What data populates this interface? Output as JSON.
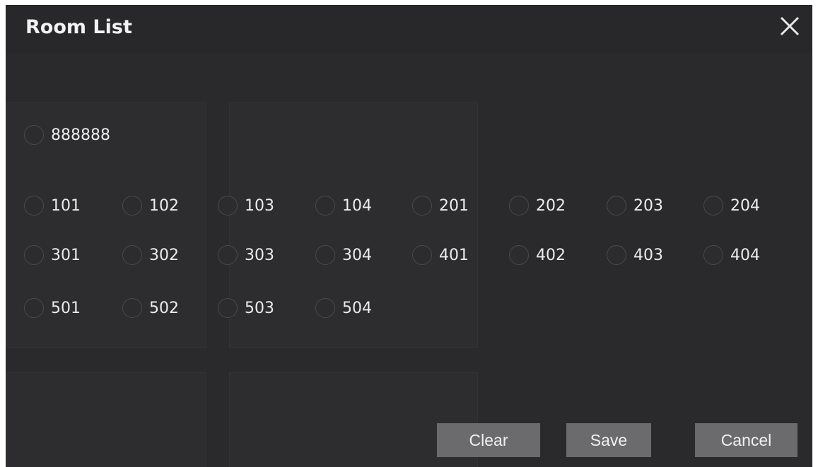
{
  "dialog": {
    "title": "Room List",
    "close_icon": "close-icon"
  },
  "rooms": {
    "row0": [
      "888888"
    ],
    "row1": [
      "101",
      "102",
      "103",
      "104",
      "201",
      "202",
      "203",
      "204"
    ],
    "row2": [
      "301",
      "302",
      "303",
      "304",
      "401",
      "402",
      "403",
      "404"
    ],
    "row3": [
      "501",
      "502",
      "503",
      "504"
    ]
  },
  "buttons": {
    "clear": "Clear",
    "save": "Save",
    "cancel": "Cancel"
  },
  "colors": {
    "dialog_bg": "#2a2a2c",
    "button_bg": "#6b6b6d",
    "text": "#ececec"
  }
}
